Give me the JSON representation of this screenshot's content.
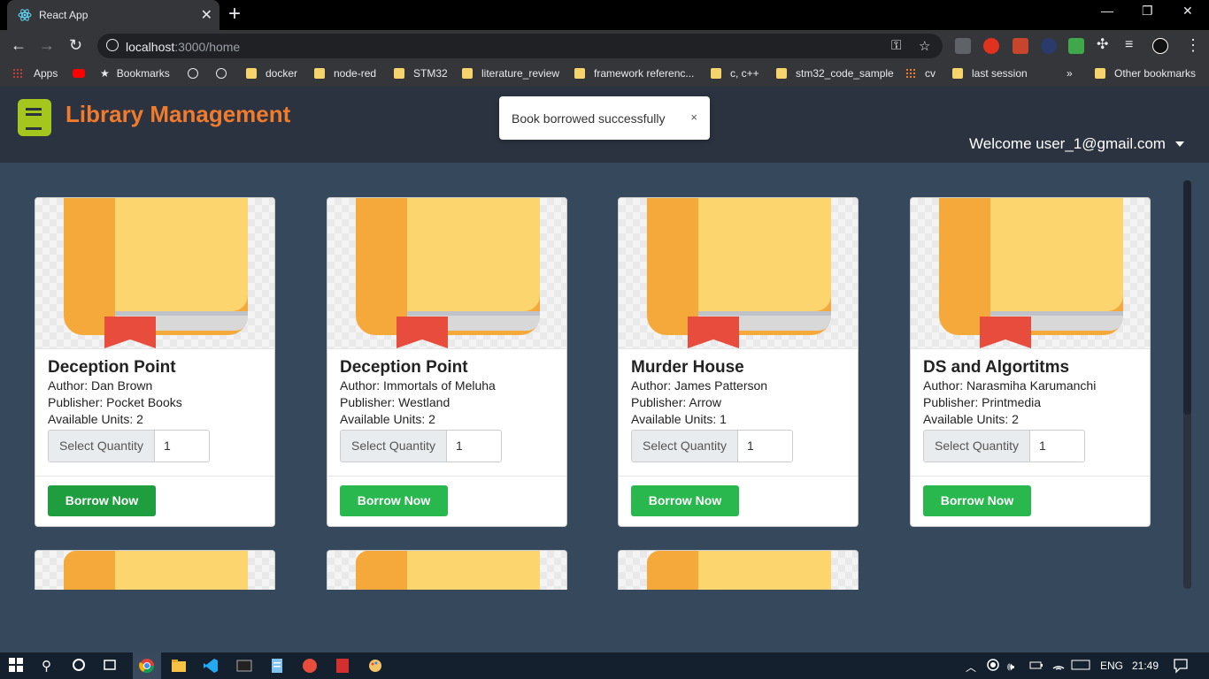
{
  "browser": {
    "tab_title": "React App",
    "url_host": "localhost",
    "url_rest": ":3000/home",
    "bookmarks": [
      {
        "label": "Apps"
      },
      {
        "label": "Bookmarks"
      },
      {
        "label": "docker"
      },
      {
        "label": "node-red"
      },
      {
        "label": "STM32"
      },
      {
        "label": "literature_review"
      },
      {
        "label": "framework referenc..."
      },
      {
        "label": "c, c++"
      },
      {
        "label": "stm32_code_sample"
      },
      {
        "label": "cv"
      },
      {
        "label": "last session"
      },
      {
        "label": "Other bookmarks"
      }
    ],
    "overflow": "»"
  },
  "header": {
    "brand": "Library Management",
    "welcome": "Welcome user_1@gmail.com"
  },
  "toast": {
    "message": "Book borrowed successfully",
    "close": "×"
  },
  "books": [
    {
      "title": "Deception Point",
      "author": "Author: Dan Brown",
      "publisher": "Publisher: Pocket Books",
      "units": "Available Units: 2",
      "qty_label": "Select Quantity",
      "qty_value": "1",
      "button": "Borrow Now"
    },
    {
      "title": "Deception Point",
      "author": "Author: Immortals of Meluha",
      "publisher": "Publisher: Westland",
      "units": "Available Units: 2",
      "qty_label": "Select Quantity",
      "qty_value": "1",
      "button": "Borrow Now"
    },
    {
      "title": "Murder House",
      "author": "Author: James Patterson",
      "publisher": "Publisher: Arrow",
      "units": "Available Units: 1",
      "qty_label": "Select Quantity",
      "qty_value": "1",
      "button": "Borrow Now"
    },
    {
      "title": "DS and Algortitms",
      "author": "Author: Narasmiha Karumanchi",
      "publisher": "Publisher: Printmedia",
      "units": "Available Units: 2",
      "qty_label": "Select Quantity",
      "qty_value": "1",
      "button": "Borrow Now"
    }
  ],
  "taskbar": {
    "language": "ENG",
    "time": "21:49"
  },
  "colors": {
    "brand": "#f07b2c",
    "button": "#28b84e",
    "page_bg": "#35485c",
    "header_bg": "#2b3340"
  }
}
